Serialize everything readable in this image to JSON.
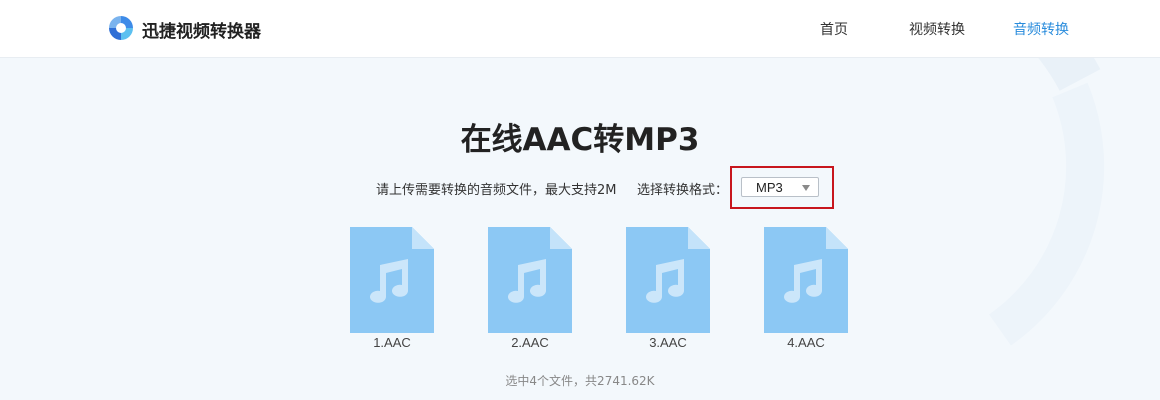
{
  "brand": {
    "name": "迅捷视频转换器",
    "logo": "brand-logo-icon"
  },
  "nav": [
    {
      "label": "首页",
      "active": false
    },
    {
      "label": "视频转换",
      "active": false
    },
    {
      "label": "音频转换",
      "active": true
    }
  ],
  "main": {
    "title": "在线AAC转MP3",
    "upload_hint": "请上传需要转换的音频文件，最大支持2M",
    "format_label": "选择转换格式：",
    "format_select": {
      "value": "MP3"
    }
  },
  "files": [
    {
      "name": "1.AAC",
      "icon": "audio-file-icon"
    },
    {
      "name": "2.AAC",
      "icon": "audio-file-icon"
    },
    {
      "name": "3.AAC",
      "icon": "audio-file-icon"
    },
    {
      "name": "4.AAC",
      "icon": "audio-file-icon"
    }
  ],
  "summary": "选中4个文件，共2741.62K",
  "colors": {
    "accent": "#2a8cdc",
    "highlight_border": "#c8161d",
    "file_icon": "#8cc8f4",
    "page_bg": "#f3f8fc"
  }
}
